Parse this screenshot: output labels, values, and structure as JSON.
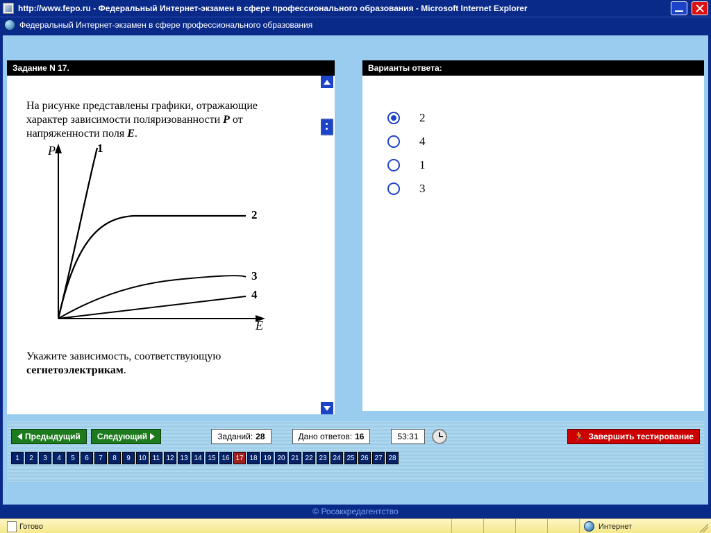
{
  "window": {
    "title": "http://www.fepo.ru - Федеральный Интернет-экзамен в сфере профессионального образования - Microsoft Internet Explorer",
    "tab_label": "Федеральный Интернет-экзамен в сфере профессионального образования"
  },
  "question_panel": {
    "header": "Задание N 17.",
    "paragraph_a": "На рисунке представлены графики, отражающие характер зависимости поляризованности ",
    "var_P": "P",
    "paragraph_b": " от напряженности поля ",
    "var_E": "E",
    "paragraph_tail": ".",
    "followup_a": "Укажите зависимость, соответствующую ",
    "followup_b": "сегнетоэлектрикам",
    "followup_tail": "."
  },
  "graph": {
    "y_label": "P",
    "x_label": "E",
    "curve_labels": {
      "c1": "1",
      "c2": "2",
      "c3": "3",
      "c4": "4"
    }
  },
  "answers_panel": {
    "header": "Варианты ответа:",
    "options": [
      {
        "label": "2",
        "selected": true
      },
      {
        "label": "4",
        "selected": false
      },
      {
        "label": "1",
        "selected": false
      },
      {
        "label": "3",
        "selected": false
      }
    ]
  },
  "nav": {
    "prev": "Предыдущий",
    "next": "Следующий",
    "total_label": "Заданий:",
    "total_value": "28",
    "answered_label": "Дано ответов:",
    "answered_value": "16",
    "timer": "53:31",
    "finish": "Завершить тестирование"
  },
  "qnav": {
    "count": 28,
    "current": 17
  },
  "footer_credit": "© Росаккредагентство",
  "statusbar": {
    "ready": "Готово",
    "zone": "Интернет"
  }
}
